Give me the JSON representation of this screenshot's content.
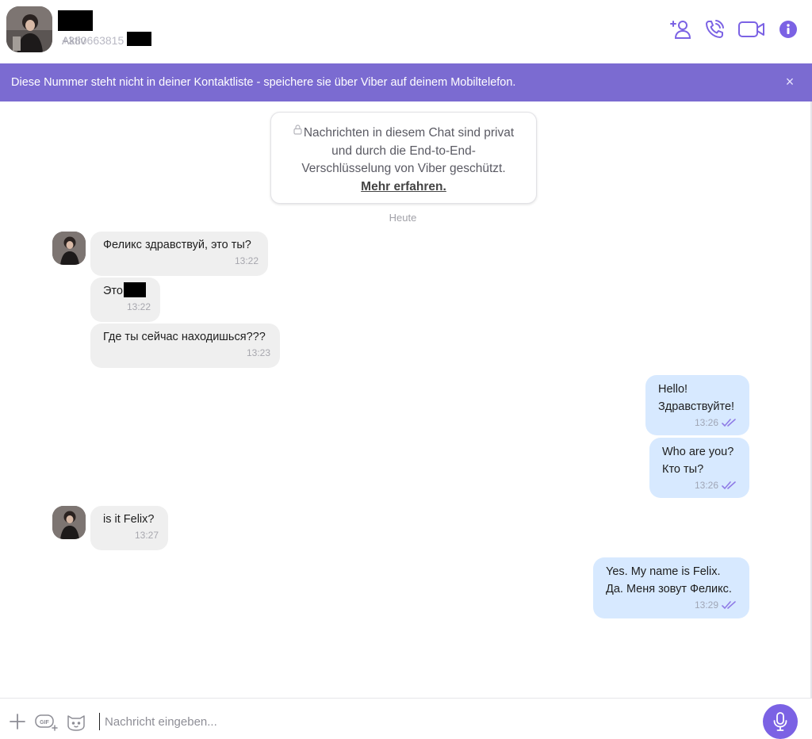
{
  "header": {
    "status_text": "Aktiv",
    "phone_fragment": "+380663815",
    "icons": [
      "add-contact-icon",
      "phone-call-icon",
      "video-call-icon",
      "info-icon"
    ]
  },
  "banner": {
    "text": "Diese Nummer steht nicht in deiner Kontaktliste - speichere sie über Viber auf deinem Mobiltelefon.",
    "close": "×"
  },
  "e2e_notice": {
    "text": "Nachrichten in diesem Chat sind privat\nund durch die End-to-End-\nVerschlüsselung von Viber geschützt.",
    "link": "Mehr erfahren."
  },
  "date_separator": "Heute",
  "messages": [
    {
      "direction": "in",
      "text": "Феликс здравствуй, это ты?",
      "time": "13:22"
    },
    {
      "direction": "in",
      "text": "Это",
      "time": "13:22"
    },
    {
      "direction": "in",
      "text": "Где ты сейчас находишься???",
      "time": "13:23"
    },
    {
      "direction": "out",
      "text": "Hello!\nЗдравствуйте!",
      "time": "13:26"
    },
    {
      "direction": "out",
      "text": "Who are you?\nКто ты?",
      "time": "13:26"
    },
    {
      "direction": "in",
      "text": "is it Felix?",
      "time": "13:27"
    },
    {
      "direction": "out",
      "text": "Yes. My name is Felix.\nДа. Меня зовут Феликс.",
      "time": "13:29"
    }
  ],
  "composer": {
    "placeholder": "Nachricht eingeben...",
    "icons": [
      "plus-icon",
      "gif-icon",
      "sticker-icon",
      "microphone-icon"
    ]
  },
  "colors": {
    "accent": "#7b62e4",
    "banner": "#7b6bd1",
    "incoming_bubble": "#efefef",
    "outgoing_bubble": "#d7e9ff"
  }
}
